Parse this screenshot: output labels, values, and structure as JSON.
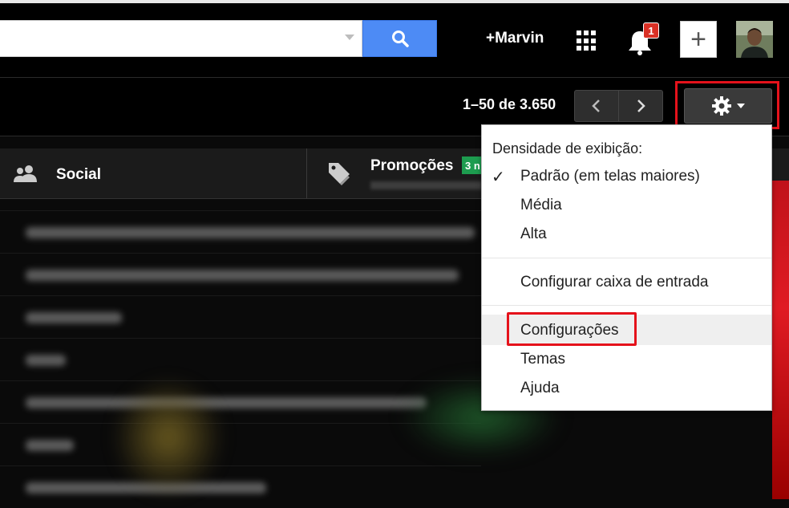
{
  "header": {
    "search_placeholder": "",
    "plus_name": "+Marvin",
    "notifications_count": "1",
    "compose_symbol": "+"
  },
  "toolbar": {
    "page_count": "1–50 de 3.650"
  },
  "tabs": [
    {
      "label": "Social"
    },
    {
      "label": "Promoções",
      "badge": "3 n"
    }
  ],
  "settings_menu": {
    "heading": "Densidade de exibição:",
    "density_options": [
      {
        "label": "Padrão (em telas maiores)",
        "checked": true
      },
      {
        "label": "Média",
        "checked": false
      },
      {
        "label": "Alta",
        "checked": false
      }
    ],
    "configure_inbox": "Configurar caixa de entrada",
    "settings": "Configurações",
    "themes": "Temas",
    "help": "Ajuda"
  },
  "colors": {
    "accent_blue": "#4d8bf5",
    "highlight_red": "#e5121b",
    "badge_green": "#1d9c4f"
  }
}
